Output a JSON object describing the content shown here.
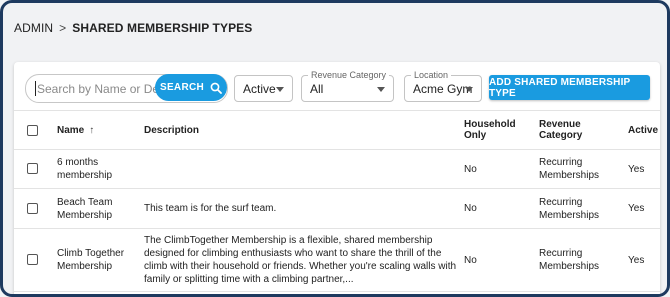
{
  "breadcrumb": {
    "root": "ADMIN",
    "separator": ">",
    "current": "SHARED MEMBERSHIP TYPES"
  },
  "toolbar": {
    "search_placeholder": "Search by Name or Description",
    "search_value": "",
    "search_button_label": "SEARCH",
    "status_value": "Active",
    "revenue_category_label": "Revenue Category",
    "revenue_category_value": "All",
    "location_label": "Location",
    "location_value": "Acme Gym",
    "add_button_label": "ADD SHARED MEMBERSHIP TYPE"
  },
  "table": {
    "headers": {
      "name": "Name",
      "description": "Description",
      "household_only": "Household Only",
      "revenue_category": "Revenue Category",
      "active": "Active"
    },
    "rows": [
      {
        "name": "6 months membership",
        "description": "",
        "household_only": "No",
        "revenue_category": "Recurring Memberships",
        "active": "Yes"
      },
      {
        "name": "Beach Team Membership",
        "description": "This team is for the surf team.",
        "household_only": "No",
        "revenue_category": "Recurring Memberships",
        "active": "Yes"
      },
      {
        "name": "Climb Together Membership",
        "description": "The ClimbTogether Membership is a flexible, shared membership designed for climbing enthusiasts who want to share the thrill of the climb with their household or friends. Whether you're scaling walls with family or splitting time with a climbing partner,...",
        "household_only": "No",
        "revenue_category": "Recurring Memberships",
        "active": "Yes"
      }
    ]
  },
  "colors": {
    "accent": "#1a9be0",
    "frame": "#1e3a5f"
  },
  "icons": {
    "search": "search-icon",
    "sort": "arrow-up-icon",
    "dropdown": "caret-down-icon"
  }
}
